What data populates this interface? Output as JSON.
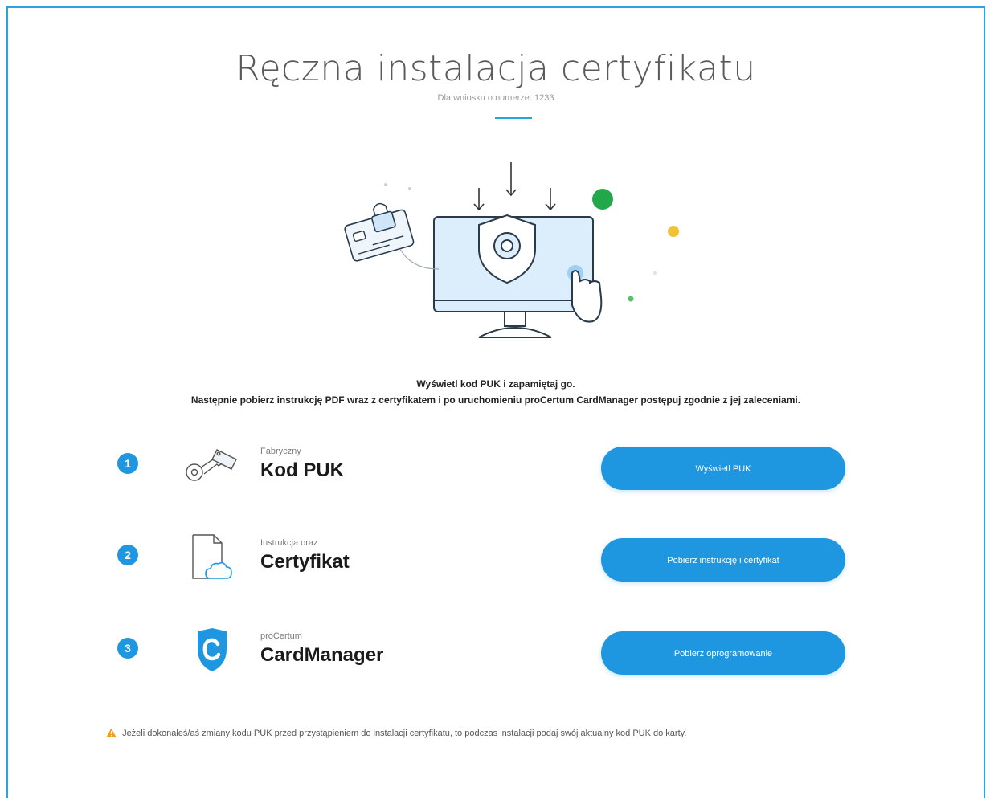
{
  "header": {
    "title": "Ręczna instalacja certyfikatu",
    "subtitle": "Dla wniosku o numerze: 1233"
  },
  "instructions": {
    "line1": "Wyświetl kod PUK i zapamiętaj go.",
    "line2": "Następnie pobierz instrukcję PDF wraz z certyfikatem i po uruchomieniu proCertum CardManager postępuj zgodnie z jej zaleceniami."
  },
  "steps": [
    {
      "number": "1",
      "icon": "key-tag-icon",
      "small": "Fabryczny",
      "big": "Kod PUK",
      "button": "Wyświetl PUK"
    },
    {
      "number": "2",
      "icon": "document-cloud-icon",
      "small": "Instrukcja oraz",
      "big": "Certyfikat",
      "button": "Pobierz instrukcję i certyfikat"
    },
    {
      "number": "3",
      "icon": "shield-c-icon",
      "small": "proCertum",
      "big": "CardManager",
      "button": "Pobierz oprogramowanie"
    }
  ],
  "warning": {
    "icon": "warning-triangle-icon",
    "text": "Jeżeli dokonałeś/aś zmiany kodu PUK przed przystąpieniem do instalacji certyfikatu, to podczas instalacji podaj swój aktualny kod PUK do karty."
  },
  "colors": {
    "accent": "#1e96e0",
    "frame": "#2aa2dc",
    "warning": "#f0a020",
    "green_dot": "#22a84a",
    "yellow_dot": "#f2c230"
  }
}
